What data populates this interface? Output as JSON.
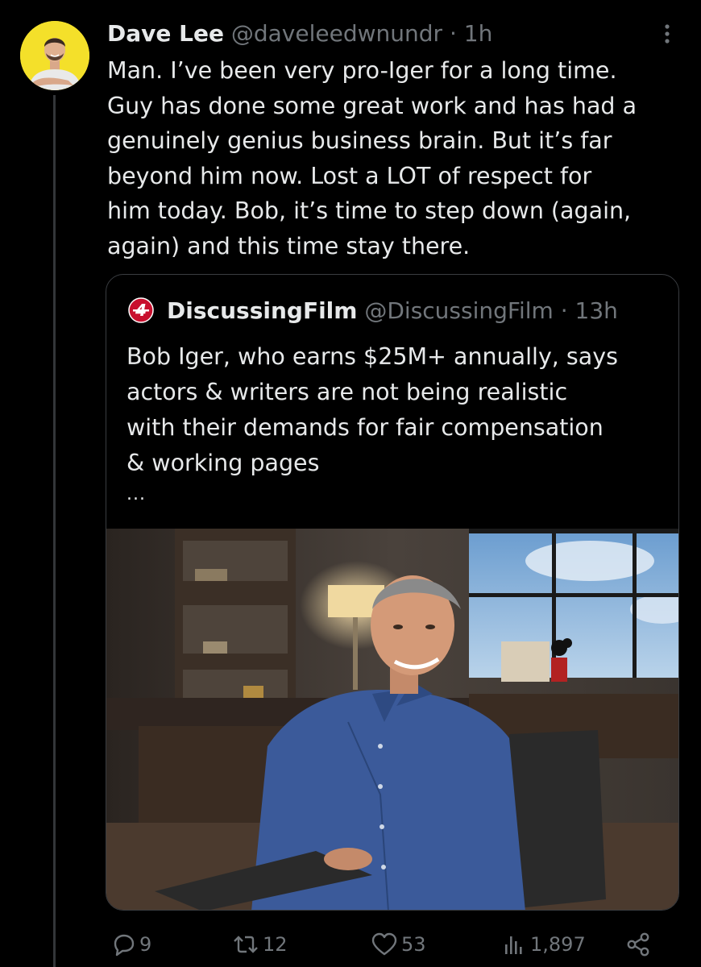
{
  "tweet": {
    "author": {
      "name": "Dave Lee",
      "handle": "@daveleedwnundr",
      "separator": "·",
      "time": "1h",
      "avatar_icon": "avatar-illustration-icon",
      "avatar_bg": "#f4e02a"
    },
    "text": "Man. I’ve been very pro-Iger for a long time.\nGuy has done some great work and has had a\ngenuinely genius business brain. But it’s far\nbeyond him now. Lost a LOT of respect for\nhim today. Bob, it’s time to step down (again,\nagain) and this time stay there.",
    "more_icon": "more-vertical-icon"
  },
  "quote": {
    "logo_icon": "discussingfilm-logo-icon",
    "logo_color": "#c8102e",
    "name": "DiscussingFilm",
    "handle": "@DiscussingFilm",
    "separator": "·",
    "time": "13h",
    "text": "Bob Iger, who earns $25M+ annually, says\nactors & writers are not being realistic\nwith their demands for fair compensation\n& working pages",
    "ellipsis": "...",
    "image_icon": "office-portrait-photo"
  },
  "actions": {
    "replies": {
      "icon": "reply-icon",
      "count": "9"
    },
    "reposts": {
      "icon": "repost-icon",
      "count": "12"
    },
    "likes": {
      "icon": "like-icon",
      "count": "53"
    },
    "views": {
      "icon": "views-icon",
      "count": "1,897"
    },
    "share": {
      "icon": "share-icon"
    }
  },
  "colors": {
    "background": "#000000",
    "text_primary": "#e7e9ea",
    "text_secondary": "#71767b",
    "border": "#3a3d41"
  }
}
